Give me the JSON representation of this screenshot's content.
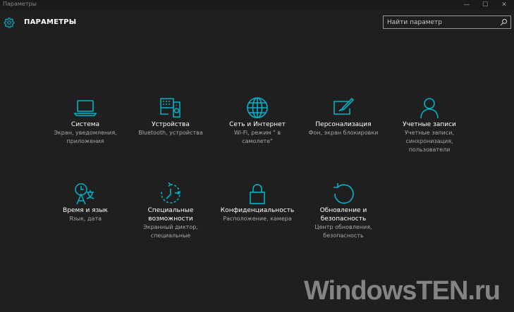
{
  "window": {
    "title": "Параметры",
    "controls": {
      "minimize": "—",
      "maximize": "☐",
      "close": "✕"
    }
  },
  "header": {
    "title": "ПАРАМЕТРЫ",
    "search_placeholder": "Найти параметр"
  },
  "accent_color": "#00b4c8",
  "tiles": [
    {
      "icon": "laptop-icon",
      "name": "Система",
      "desc": "Экран, уведомления, приложения"
    },
    {
      "icon": "devices-icon",
      "name": "Устройства",
      "desc": "Bluetooth, устройства"
    },
    {
      "icon": "globe-icon",
      "name": "Сеть и Интернет",
      "desc": "Wi-Fi, режим \" в самолете\""
    },
    {
      "icon": "personalization-icon",
      "name": "Персонализация",
      "desc": "Фон, экран блокировки"
    },
    {
      "icon": "person-icon",
      "name": "Учетные записи",
      "desc": "Учетные записи, синхронизация, пользователи"
    },
    {
      "icon": "time-language-icon",
      "name": "Время и язык",
      "desc": "Язык, дата"
    },
    {
      "icon": "accessibility-icon",
      "name": "Специальные возможности",
      "desc": "Экранный диктор, специальные"
    },
    {
      "icon": "lock-icon",
      "name": "Конфиденциальность",
      "desc": "Расположение, камера"
    },
    {
      "icon": "update-icon",
      "name": "Обновление и безопасность",
      "desc": "Центр обновления, безопасность"
    }
  ],
  "watermark": "WindowsTEN.ru"
}
